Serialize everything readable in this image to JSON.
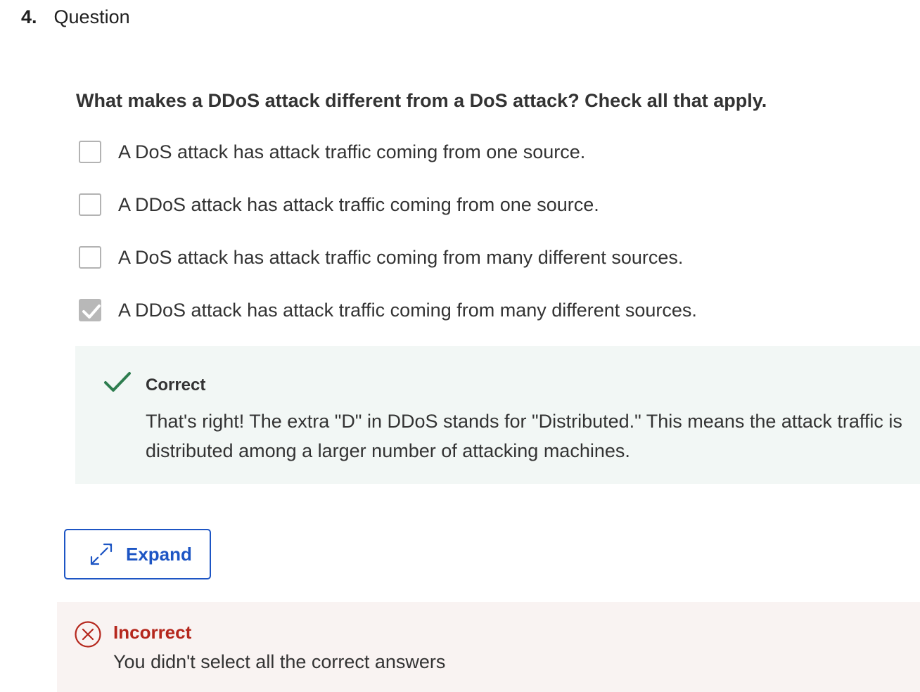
{
  "question": {
    "number": "4.",
    "label": "Question",
    "prompt": "What makes a DDoS attack different from a DoS attack? Check all that apply."
  },
  "options": [
    {
      "text": "A DoS attack has attack traffic coming from one source.",
      "checked": false
    },
    {
      "text": "A DDoS attack has attack traffic coming from one source.",
      "checked": false
    },
    {
      "text": "A DoS attack has attack traffic coming from many different sources.",
      "checked": false
    },
    {
      "text": "A DDoS attack has attack traffic coming from many different sources.",
      "checked": true
    }
  ],
  "feedback_correct": {
    "title": "Correct",
    "body": "That's right! The extra \"D\" in DDoS stands for \"Distributed.\" This means the attack traffic is distributed among a larger number of attacking machines.",
    "icon": "checkmark-icon",
    "color": "#2e7d4f"
  },
  "expand_button": {
    "label": "Expand",
    "icon": "expand-arrows-icon",
    "color": "#1d55c4"
  },
  "feedback_incorrect": {
    "title": "Incorrect",
    "body": "You didn't select all the correct answers",
    "icon": "x-circle-icon",
    "color": "#b5271d"
  }
}
